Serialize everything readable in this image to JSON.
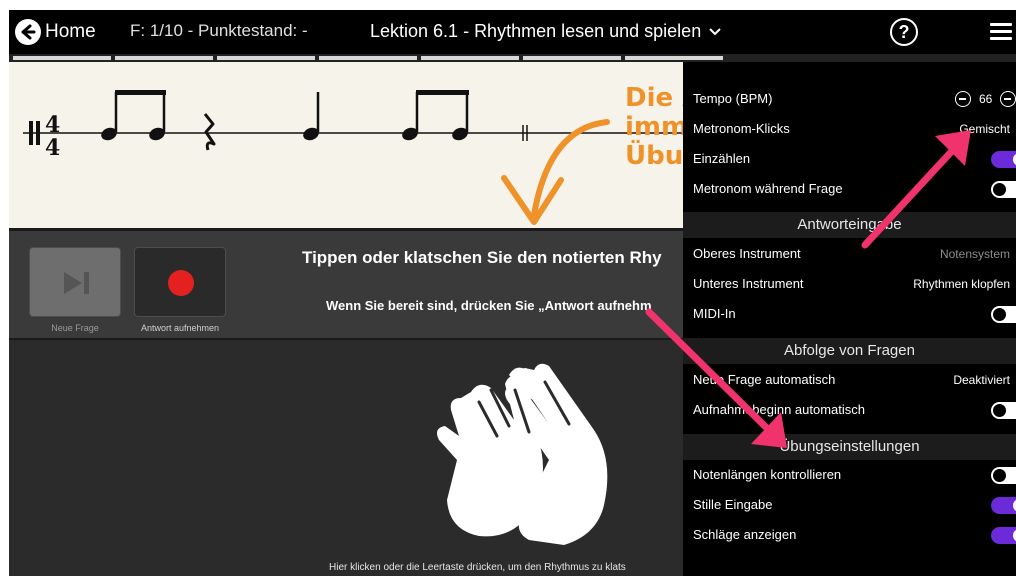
{
  "topbar": {
    "home_label": "Home",
    "status": "F: 1/10 - Punktestand: -",
    "lesson_title": "Lektion 6.1 - Rhythmen lesen und spielen"
  },
  "score": {
    "time_signature_top": "4",
    "time_signature_bottom": "4",
    "orange_lines": [
      "Die A",
      "imme",
      "Übun"
    ]
  },
  "controls": {
    "next_caption": "Neue Frage",
    "record_caption": "Antwort aufnehmen",
    "instruction_main": "Tippen oder klatschen Sie den notierten Rhy",
    "instruction_sub": "Wenn Sie bereit sind, drücken Sie „Antwort aufnehm",
    "clap_hint": "Hier klicken oder die Leertaste drücken, um den Rhythmus zu klats"
  },
  "settings": {
    "tempo_label": "Tempo (BPM)",
    "tempo_value": "66",
    "metronome_clicks_label": "Metronom-Klicks",
    "metronome_clicks_value": "Gemischt",
    "count_in_label": "Einzählen",
    "metronome_during_label": "Metronom während Frage",
    "section_answer": "Antworteingabe",
    "upper_instrument_label": "Oberes Instrument",
    "upper_instrument_value": "Notensystem",
    "lower_instrument_label": "Unteres Instrument",
    "lower_instrument_value": "Rhythmen klopfen",
    "midi_label": "MIDI-In",
    "section_sequence": "Abfolge von Fragen",
    "new_question_auto_label": "Neue Frage automatisch",
    "new_question_auto_value": "Deaktiviert",
    "record_auto_label": "Aufnahmebeginn automatisch",
    "section_exercise": "Übungseinstellungen",
    "check_lengths_label": "Notenlängen kontrollieren",
    "silent_input_label": "Stille Eingabe",
    "show_beats_label": "Schläge anzeigen"
  },
  "colors": {
    "accent_purple": "#6b2bd9",
    "arrow_pink": "#f0336c",
    "orange": "#f0922a",
    "record_red": "#e52020"
  },
  "toggles": {
    "count_in": true,
    "metronome_during": false,
    "midi_in": false,
    "record_auto": false,
    "check_lengths": false,
    "silent_input": true,
    "show_beats": true
  }
}
